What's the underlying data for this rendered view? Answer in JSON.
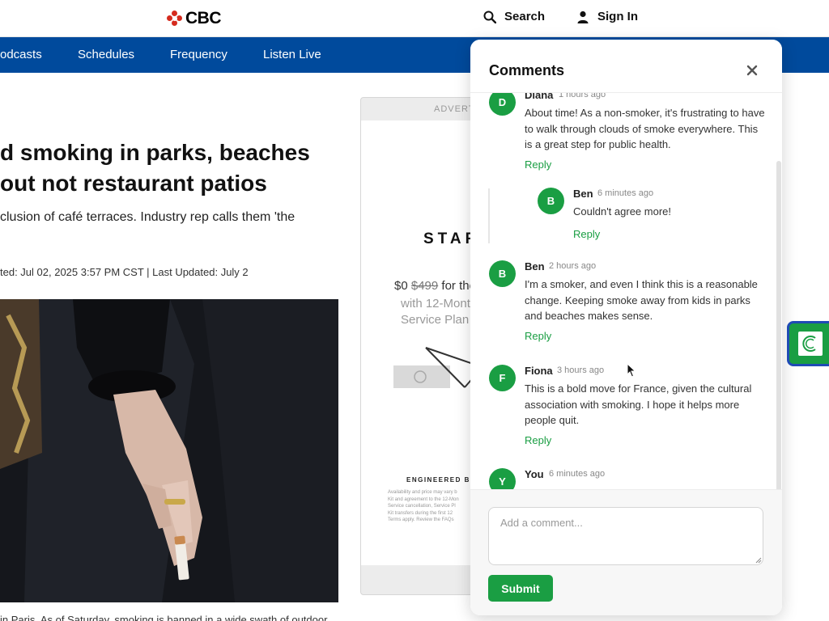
{
  "header": {
    "logo_text": "CBC",
    "search_label": "Search",
    "signin_label": "Sign In"
  },
  "nav": {
    "items": [
      "odcasts",
      "Schedules",
      "Frequency",
      "Listen Live"
    ]
  },
  "article": {
    "headline_line1": "d smoking in parks, beaches",
    "headline_line2": "out not restaurant patios",
    "subhead": "clusion of café terraces. Industry rep calls them 'the",
    "dateline": "ted: Jul 02, 2025 3:57 PM CST | Last Updated: July 2",
    "caption": "in Paris. As of Saturday, smoking is banned in a wide swath of outdoor"
  },
  "ad": {
    "label": "ADVERTI",
    "brand": "STAR",
    "price_now": "$0",
    "price_old": "$499",
    "price_rest": "for the",
    "sub_line1": "with 12-Mont",
    "sub_line2": "Service Plan",
    "engineered": "ENGINEERED B",
    "fine_lines": [
      "Availability and price may vary b",
      "Kit and agreement to the 12-Mon",
      "Service cancellation, Service Pl",
      "Kit transfers during the first 12",
      "Terms apply. Review the FAQs"
    ]
  },
  "comments_panel": {
    "title": "Comments",
    "reply_label": "Reply",
    "comments": [
      {
        "initial": "D",
        "name": "Diana",
        "time": "1 hours ago",
        "text": "About time! As a non-smoker, it's frustrating to have to walk through clouds of smoke everywhere. This is a great step for public health."
      },
      {
        "initial": "B",
        "name": "Ben",
        "time": "6 minutes ago",
        "text": "Couldn't agree more!"
      },
      {
        "initial": "B",
        "name": "Ben",
        "time": "2 hours ago",
        "text": "I'm a smoker, and even I think this is a reasonable change. Keeping smoke away from kids in parks and beaches makes sense."
      },
      {
        "initial": "F",
        "name": "Fiona",
        "time": "3 hours ago",
        "text": "This is a bold move for France, given the cultural association with smoking. I hope it helps more people quit."
      },
      {
        "initial": "Y",
        "name": "You",
        "time": "6 minutes ago",
        "text": ""
      }
    ],
    "comment_placeholder": "Add a comment...",
    "submit_label": "Submit"
  },
  "colors": {
    "nav_blue": "#004a9c",
    "accent_green": "#1a9e43",
    "brand_red": "#d52b1e",
    "widget_border": "#1f4bb5"
  },
  "icons": {
    "search": "search-icon",
    "user": "user-icon",
    "close": "close-icon",
    "widget": "c-logo-icon",
    "cursor": "mouse-cursor-icon"
  }
}
